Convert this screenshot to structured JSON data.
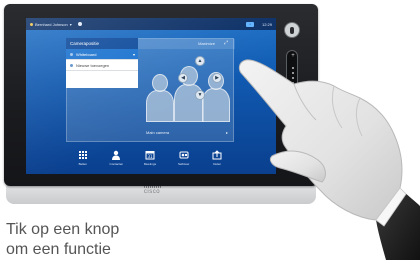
{
  "device": {
    "brand_logo": "cisco",
    "screen": {
      "topbar": {
        "user_name": "Bernhard Johnson",
        "dropdown_caret": "▾",
        "clock": "12:29"
      },
      "panel": {
        "header_left": "Selfview",
        "header_right": "Maximize"
      },
      "sidemenu": {
        "header": "Camerapositie",
        "items": [
          {
            "label": "Whiteboard",
            "selected": true
          },
          {
            "label": "Nieuwe toevoegen",
            "selected": false
          }
        ]
      },
      "camera_label": "Main camera",
      "controls": {
        "up": "▲",
        "down": "▼",
        "left": "◀",
        "right": "▶"
      },
      "dock": [
        {
          "icon": "keypad-icon",
          "label": "Bellen"
        },
        {
          "icon": "contacts-icon",
          "label": "Contacten"
        },
        {
          "icon": "calendar-icon",
          "label": "Meetings"
        },
        {
          "icon": "camera-icon",
          "label": "Selfview"
        },
        {
          "icon": "share-icon",
          "label": "Delen"
        }
      ]
    },
    "volume": {
      "plus": "+",
      "minus": "−"
    }
  },
  "caption": {
    "line1": "Tik op een knop",
    "line2": "om een functie"
  },
  "colors": {
    "screen_top": "#1c6fc6",
    "screen_bottom": "#0a3f8e",
    "menu_header": "#0d4a9b",
    "menu_selected": "#1a72cf",
    "caption_text": "#555555"
  }
}
